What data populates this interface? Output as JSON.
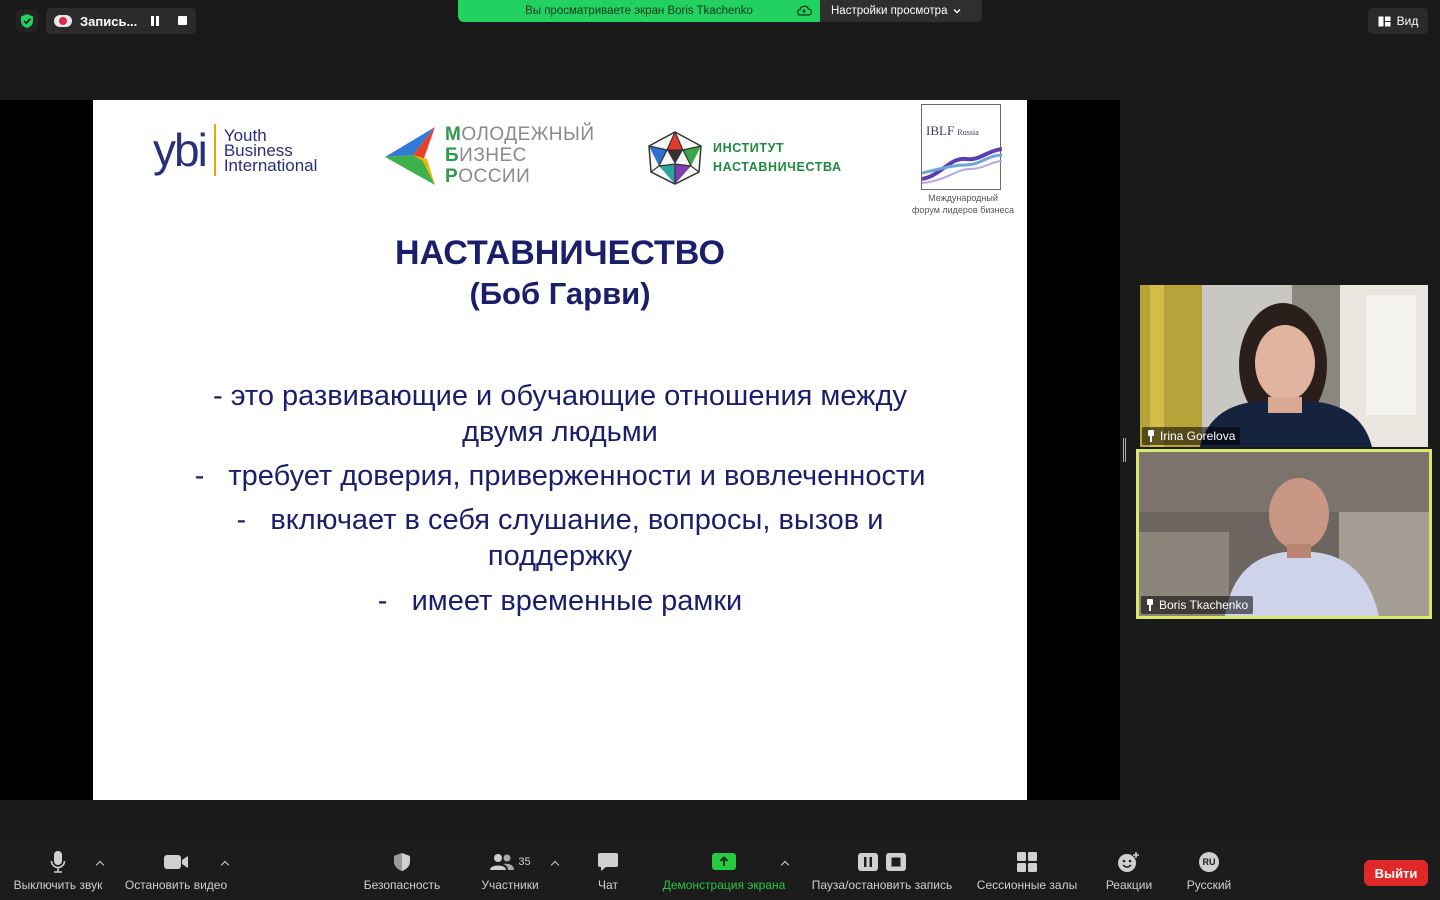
{
  "top_bar": {
    "recording_label": "Запись...",
    "share_banner": "Вы просматриваете экран Boris Tkachenko",
    "view_settings": "Настройки просмотра",
    "view_button": "Вид"
  },
  "slide": {
    "logos": {
      "ybi_mark": "ybi",
      "ybi_line1": "Youth",
      "ybi_line2": "Business",
      "ybi_line3": "International",
      "mbr_line1_first": "М",
      "mbr_line1_rest": "ОЛОДЕЖНЫЙ",
      "mbr_line2_first": "Б",
      "mbr_line2_rest": "ИЗНЕС",
      "mbr_line3_first": "Р",
      "mbr_line3_rest": "ОССИИ",
      "inst_line1": "ИНСТИТУТ",
      "inst_line2": "НАСТАВНИЧЕСТВА",
      "iblf_title": "IBLF",
      "iblf_small": "Russia",
      "iblf_caption1": "Международный",
      "iblf_caption2": "форум лидеров бизнеса"
    },
    "title": "НАСТАВНИЧЕСТВО",
    "subtitle": "(Боб Гарви)",
    "bullets": [
      "- это развивающие и обучающие отношения между",
      "двумя людьми",
      "-   требует доверия, приверженности и вовлеченности",
      "-   включает в себя слушание, вопросы, вызов и",
      "поддержку",
      "-   имеет временные рамки"
    ]
  },
  "participants": [
    {
      "name": "Irina Gorelova",
      "active_speaker": false
    },
    {
      "name": "Boris Tkachenko",
      "active_speaker": true
    }
  ],
  "toolbar": {
    "mute": "Выключить звук",
    "video": "Остановить видео",
    "security": "Безопасность",
    "participants": "Участники",
    "participants_count": "35",
    "chat": "Чат",
    "share": "Демонстрация экрана",
    "record": "Пауза/остановить запись",
    "breakout": "Сессионные залы",
    "reactions": "Реакции",
    "language": "Русский",
    "language_badge": "RU",
    "leave": "Выйти"
  },
  "colors": {
    "accent_green": "#23d160",
    "share_green": "#27c93f",
    "leave_red": "#e02828",
    "speaker_border": "#d7e86a",
    "slide_text": "#1b1f6b"
  }
}
